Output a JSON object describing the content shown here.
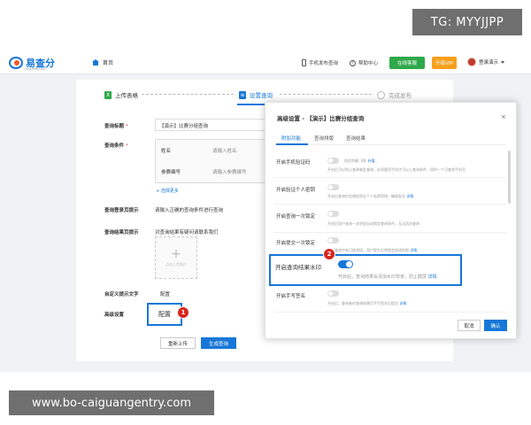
{
  "overlay": {
    "top_label": "TG: MYYJJPP",
    "bottom_label": "www.bo-caiguangentry.com"
  },
  "header": {
    "logo_text": "易查分",
    "logo_sub": "YICHAFEN.COM",
    "home": "首页",
    "phone_publish": "手机发布查询",
    "help_center": "帮助中心",
    "online_customer": "在线客服",
    "upgrade_vip": "升级VIP",
    "user_name": "登录演示"
  },
  "steps": [
    {
      "label": "上传表格",
      "icon": "excel-icon"
    },
    {
      "label": "设置查询",
      "icon": "settings-icon"
    },
    {
      "label": "完成发布",
      "icon": "check-icon"
    }
  ],
  "form": {
    "title_label": "查询标题",
    "title_value": "【演示】比赛分组查询",
    "conditions_label": "查询条件",
    "cond_rows": [
      {
        "name": "姓名",
        "placeholder": "请输入姓名"
      },
      {
        "name": "参赛编号",
        "placeholder": "请输入参赛编号"
      }
    ],
    "add_more": "+ 选择更多",
    "login_tip_label": "查询登录页提示",
    "login_tip_value": "请输入正确的查询条件进行查询",
    "result_tip_label": "查询结果页提示",
    "result_tip_value": "对查询结果有疑问请联系我们",
    "upload_text": "点击上传图片",
    "custom_text_label": "自定义提示文字",
    "custom_text_value": "配置",
    "advanced_label": "高级设置",
    "advanced_button": "配置",
    "badge1": "1",
    "reupload": "重新上传",
    "generate": "生成查询"
  },
  "modal": {
    "title": "高级设置 - 【演示】比赛分组查询",
    "close": "×",
    "tabs": [
      "附加功能",
      "查询排版",
      "查询结果"
    ],
    "rows": [
      {
        "label": "开启手机验证码",
        "on": false,
        "desc_pre": "短信余额: 0条",
        "link": "充值",
        "desc": "开启后可以防止查询者乱查询，必须要用手机才可以上查询条件，同时一个可查验手机号"
      },
      {
        "label": "开启验证个人密钥",
        "on": false,
        "desc_pre": "",
        "link": "详情",
        "desc": "开启后查询时会增加验证个人私密密钥，确保安全"
      },
      {
        "label": "开启查询一次锁定",
        "on": false,
        "desc_pre": "",
        "link": "",
        "desc": "开启后用户查询一次则会自动锁定查询条件，无法再次查询"
      },
      {
        "label": "开启提交一次锁定",
        "on": false,
        "desc_pre": "",
        "link": "详情",
        "desc": "如果查询中有可修改项，用户提交后将锁定修改权限"
      }
    ],
    "watermark_label": "开启查询结果水印",
    "watermark_on": true,
    "watermark_desc": "开启后，查询结果会添加水印背景，防止截屏",
    "watermark_link": "详情",
    "badge2": "2",
    "signature_label": "开启手写签名",
    "signature_on": false,
    "signature_desc": "开启后，查询者在查询结果页手写签名后提交",
    "signature_link": "详情",
    "cancel": "取消",
    "confirm": "确认"
  }
}
